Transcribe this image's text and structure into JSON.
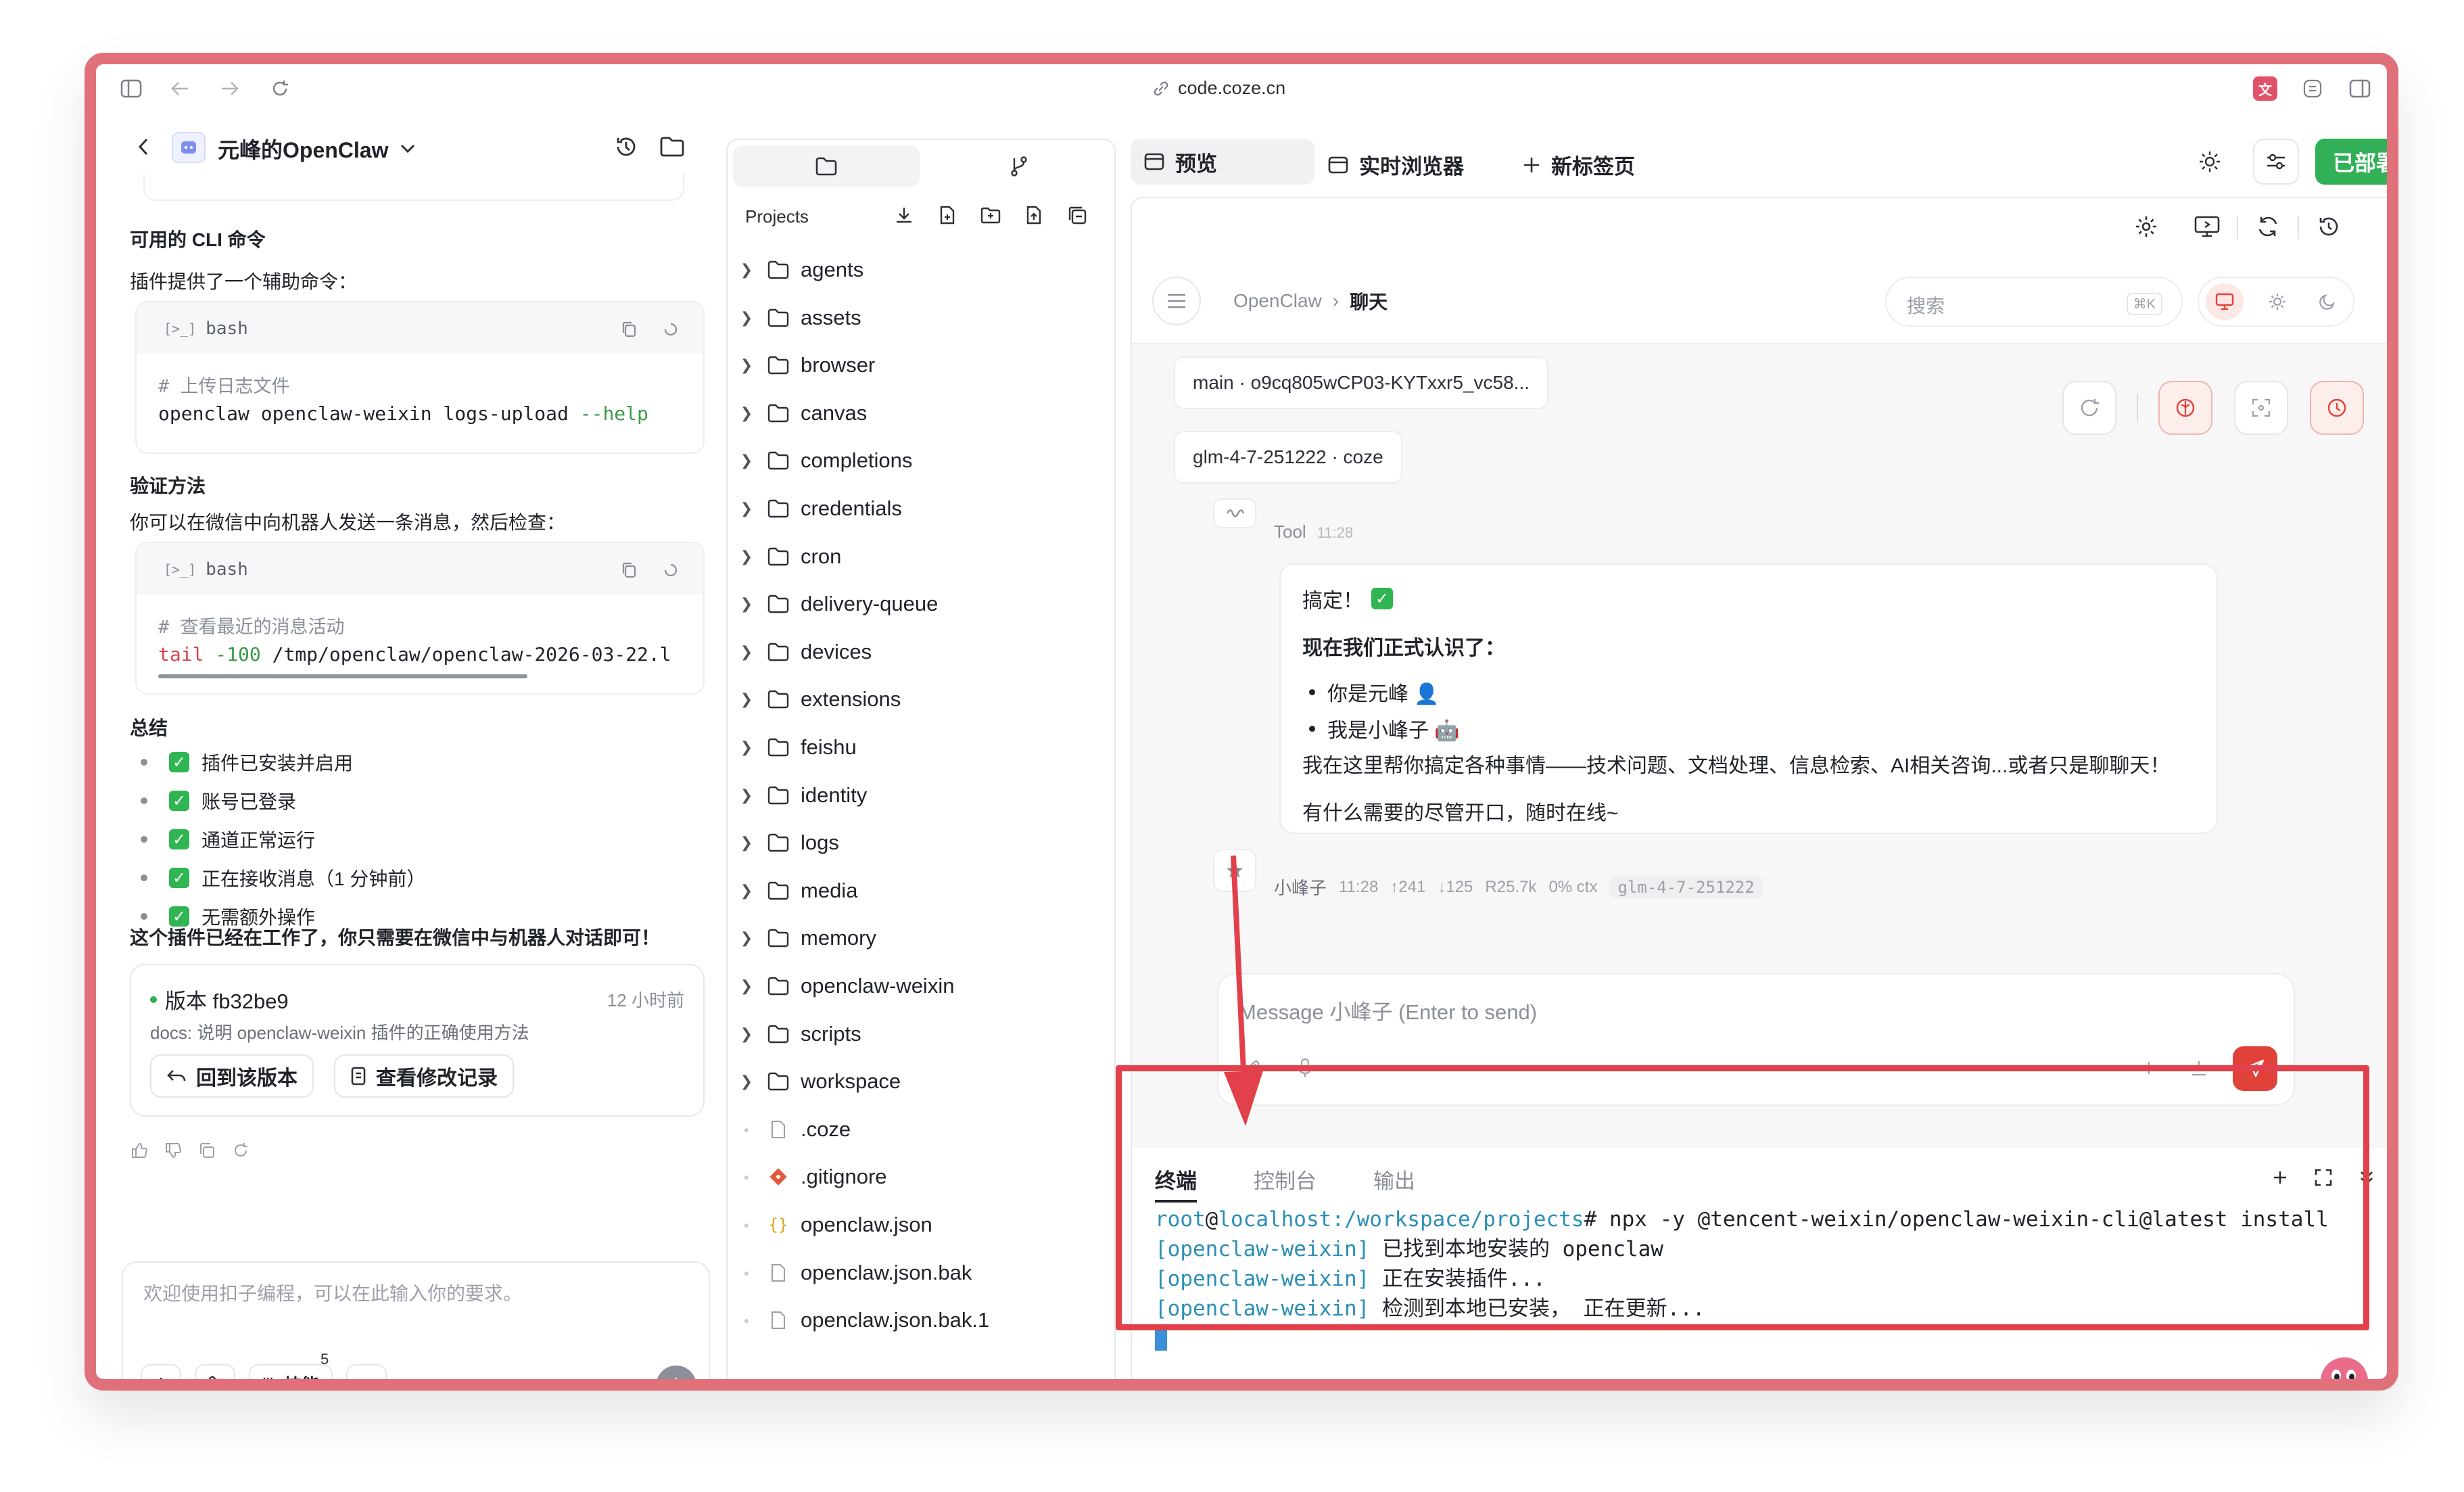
{
  "browser": {
    "url": "code.coze.cn"
  },
  "project": {
    "name": "元峰的OpenClaw"
  },
  "chat_left": {
    "section_cli": "可用的 CLI 命令",
    "cli_intro": "插件提供了一个辅助命令：",
    "code1": {
      "lang": "bash",
      "comment": "# 上传日志文件",
      "cmd": "openclaw openclaw-weixin logs-upload ",
      "flag": "--help"
    },
    "section_verify": "验证方法",
    "verify_intro": "你可以在微信中向机器人发送一条消息，然后检查：",
    "code2": {
      "lang": "bash",
      "comment": "# 查看最近的消息活动",
      "cmd_a": "tail",
      "cmd_b": " -100",
      "cmd_c": " /tmp/openclaw/openclaw-2026-03-22.l"
    },
    "section_summary": "总结",
    "summary_items": [
      "插件已安装并启用",
      "账号已登录",
      "通道正常运行",
      "正在接收消息（1 分钟前）",
      "无需额外操作"
    ],
    "conclusion": "这个插件已经在工作了，你只需要在微信中与机器人对话即可！",
    "version": {
      "title": "版本 fb32be9",
      "time": "12 小时前",
      "desc": "docs: 说明 openclaw-weixin 插件的正确使用方法",
      "rollback": "回到该版本",
      "view_changes": "查看修改记录"
    },
    "input_placeholder": "欢迎使用扣子编程，可以在此输入你的要求。",
    "skills_label": "技能",
    "skills_count": "5"
  },
  "file_tree": {
    "header": "Projects",
    "folders": [
      "agents",
      "assets",
      "browser",
      "canvas",
      "completions",
      "credentials",
      "cron",
      "delivery-queue",
      "devices",
      "extensions",
      "feishu",
      "identity",
      "logs",
      "media",
      "memory",
      "openclaw-weixin",
      "scripts",
      "workspace"
    ],
    "files": [
      ".coze",
      ".gitignore",
      "openclaw.json",
      "openclaw.json.bak",
      "openclaw.json.bak.1"
    ]
  },
  "tabs": {
    "preview": "预览",
    "browser": "实时浏览器",
    "new_tab": "新标签页",
    "deployed": "已部署"
  },
  "preview": {
    "breadcrumb_root": "OpenClaw",
    "breadcrumb_current": "聊天",
    "search_placeholder": "搜索",
    "search_shortcut": "⌘K",
    "session": "main · o9cq805wCP03-KYTxxr5_vc58...",
    "model": "glm-4-7-251222 · coze",
    "tool_label": "Tool",
    "tool_time": "11:28",
    "reply": {
      "line1": "搞定！",
      "line2": "现在我们正式认识了：",
      "bullets": [
        "你是元峰 👤",
        "我是小峰子 🤖"
      ],
      "line3": "我在这里帮你搞定各种事情——技术问题、文档处理、信息检索、AI相关咨询...或者只是聊聊天！",
      "line4": "有什么需要的尽管开口，随时在线~"
    },
    "meta": {
      "name": "小峰子",
      "time": "11:28",
      "up": "↑241",
      "down": "↓125",
      "r": "R25.7k",
      "ctx": "0% ctx",
      "model": "glm-4-7-251222"
    },
    "composer_placeholder": "Message 小峰子 (Enter to send)"
  },
  "terminal": {
    "tabs": [
      "终端",
      "控制台",
      "输出"
    ],
    "prompt_user": "root",
    "prompt_host": "localhost",
    "prompt_path": ":/workspace/projects",
    "command": "# npx -y @tencent-weixin/openclaw-weixin-cli@latest install",
    "lines": [
      {
        "tag": "[openclaw-weixin]",
        "text": " 已找到本地安装的 openclaw"
      },
      {
        "tag": "[openclaw-weixin]",
        "text": " 正在安装插件..."
      },
      {
        "tag": "[openclaw-weixin]",
        "text": " 检测到本地已安装， 正在更新..."
      }
    ]
  },
  "colors": {
    "accent_green": "#31b057",
    "highlight_red": "#e2404b",
    "terminal_cyan": "#2a8fb8",
    "send_red": "#e0423a"
  }
}
